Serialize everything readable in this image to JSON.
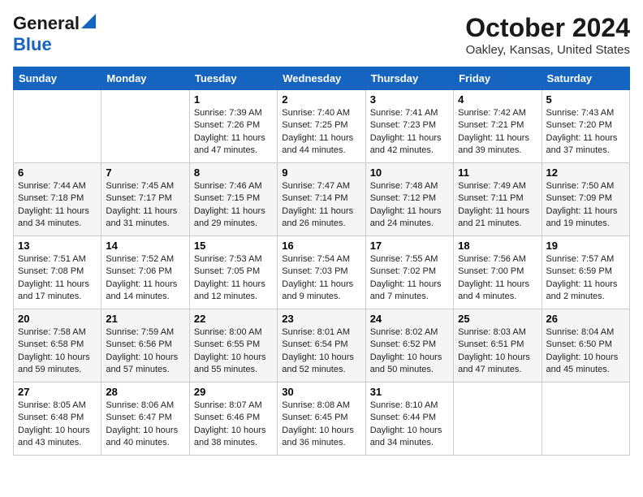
{
  "header": {
    "logo_line1": "General",
    "logo_line2": "Blue",
    "month": "October 2024",
    "location": "Oakley, Kansas, United States"
  },
  "weekdays": [
    "Sunday",
    "Monday",
    "Tuesday",
    "Wednesday",
    "Thursday",
    "Friday",
    "Saturday"
  ],
  "weeks": [
    [
      {
        "day": null
      },
      {
        "day": null
      },
      {
        "day": "1",
        "sunrise": "Sunrise: 7:39 AM",
        "sunset": "Sunset: 7:26 PM",
        "daylight": "Daylight: 11 hours and 47 minutes."
      },
      {
        "day": "2",
        "sunrise": "Sunrise: 7:40 AM",
        "sunset": "Sunset: 7:25 PM",
        "daylight": "Daylight: 11 hours and 44 minutes."
      },
      {
        "day": "3",
        "sunrise": "Sunrise: 7:41 AM",
        "sunset": "Sunset: 7:23 PM",
        "daylight": "Daylight: 11 hours and 42 minutes."
      },
      {
        "day": "4",
        "sunrise": "Sunrise: 7:42 AM",
        "sunset": "Sunset: 7:21 PM",
        "daylight": "Daylight: 11 hours and 39 minutes."
      },
      {
        "day": "5",
        "sunrise": "Sunrise: 7:43 AM",
        "sunset": "Sunset: 7:20 PM",
        "daylight": "Daylight: 11 hours and 37 minutes."
      }
    ],
    [
      {
        "day": "6",
        "sunrise": "Sunrise: 7:44 AM",
        "sunset": "Sunset: 7:18 PM",
        "daylight": "Daylight: 11 hours and 34 minutes."
      },
      {
        "day": "7",
        "sunrise": "Sunrise: 7:45 AM",
        "sunset": "Sunset: 7:17 PM",
        "daylight": "Daylight: 11 hours and 31 minutes."
      },
      {
        "day": "8",
        "sunrise": "Sunrise: 7:46 AM",
        "sunset": "Sunset: 7:15 PM",
        "daylight": "Daylight: 11 hours and 29 minutes."
      },
      {
        "day": "9",
        "sunrise": "Sunrise: 7:47 AM",
        "sunset": "Sunset: 7:14 PM",
        "daylight": "Daylight: 11 hours and 26 minutes."
      },
      {
        "day": "10",
        "sunrise": "Sunrise: 7:48 AM",
        "sunset": "Sunset: 7:12 PM",
        "daylight": "Daylight: 11 hours and 24 minutes."
      },
      {
        "day": "11",
        "sunrise": "Sunrise: 7:49 AM",
        "sunset": "Sunset: 7:11 PM",
        "daylight": "Daylight: 11 hours and 21 minutes."
      },
      {
        "day": "12",
        "sunrise": "Sunrise: 7:50 AM",
        "sunset": "Sunset: 7:09 PM",
        "daylight": "Daylight: 11 hours and 19 minutes."
      }
    ],
    [
      {
        "day": "13",
        "sunrise": "Sunrise: 7:51 AM",
        "sunset": "Sunset: 7:08 PM",
        "daylight": "Daylight: 11 hours and 17 minutes."
      },
      {
        "day": "14",
        "sunrise": "Sunrise: 7:52 AM",
        "sunset": "Sunset: 7:06 PM",
        "daylight": "Daylight: 11 hours and 14 minutes."
      },
      {
        "day": "15",
        "sunrise": "Sunrise: 7:53 AM",
        "sunset": "Sunset: 7:05 PM",
        "daylight": "Daylight: 11 hours and 12 minutes."
      },
      {
        "day": "16",
        "sunrise": "Sunrise: 7:54 AM",
        "sunset": "Sunset: 7:03 PM",
        "daylight": "Daylight: 11 hours and 9 minutes."
      },
      {
        "day": "17",
        "sunrise": "Sunrise: 7:55 AM",
        "sunset": "Sunset: 7:02 PM",
        "daylight": "Daylight: 11 hours and 7 minutes."
      },
      {
        "day": "18",
        "sunrise": "Sunrise: 7:56 AM",
        "sunset": "Sunset: 7:00 PM",
        "daylight": "Daylight: 11 hours and 4 minutes."
      },
      {
        "day": "19",
        "sunrise": "Sunrise: 7:57 AM",
        "sunset": "Sunset: 6:59 PM",
        "daylight": "Daylight: 11 hours and 2 minutes."
      }
    ],
    [
      {
        "day": "20",
        "sunrise": "Sunrise: 7:58 AM",
        "sunset": "Sunset: 6:58 PM",
        "daylight": "Daylight: 10 hours and 59 minutes."
      },
      {
        "day": "21",
        "sunrise": "Sunrise: 7:59 AM",
        "sunset": "Sunset: 6:56 PM",
        "daylight": "Daylight: 10 hours and 57 minutes."
      },
      {
        "day": "22",
        "sunrise": "Sunrise: 8:00 AM",
        "sunset": "Sunset: 6:55 PM",
        "daylight": "Daylight: 10 hours and 55 minutes."
      },
      {
        "day": "23",
        "sunrise": "Sunrise: 8:01 AM",
        "sunset": "Sunset: 6:54 PM",
        "daylight": "Daylight: 10 hours and 52 minutes."
      },
      {
        "day": "24",
        "sunrise": "Sunrise: 8:02 AM",
        "sunset": "Sunset: 6:52 PM",
        "daylight": "Daylight: 10 hours and 50 minutes."
      },
      {
        "day": "25",
        "sunrise": "Sunrise: 8:03 AM",
        "sunset": "Sunset: 6:51 PM",
        "daylight": "Daylight: 10 hours and 47 minutes."
      },
      {
        "day": "26",
        "sunrise": "Sunrise: 8:04 AM",
        "sunset": "Sunset: 6:50 PM",
        "daylight": "Daylight: 10 hours and 45 minutes."
      }
    ],
    [
      {
        "day": "27",
        "sunrise": "Sunrise: 8:05 AM",
        "sunset": "Sunset: 6:48 PM",
        "daylight": "Daylight: 10 hours and 43 minutes."
      },
      {
        "day": "28",
        "sunrise": "Sunrise: 8:06 AM",
        "sunset": "Sunset: 6:47 PM",
        "daylight": "Daylight: 10 hours and 40 minutes."
      },
      {
        "day": "29",
        "sunrise": "Sunrise: 8:07 AM",
        "sunset": "Sunset: 6:46 PM",
        "daylight": "Daylight: 10 hours and 38 minutes."
      },
      {
        "day": "30",
        "sunrise": "Sunrise: 8:08 AM",
        "sunset": "Sunset: 6:45 PM",
        "daylight": "Daylight: 10 hours and 36 minutes."
      },
      {
        "day": "31",
        "sunrise": "Sunrise: 8:10 AM",
        "sunset": "Sunset: 6:44 PM",
        "daylight": "Daylight: 10 hours and 34 minutes."
      },
      {
        "day": null
      },
      {
        "day": null
      }
    ]
  ]
}
